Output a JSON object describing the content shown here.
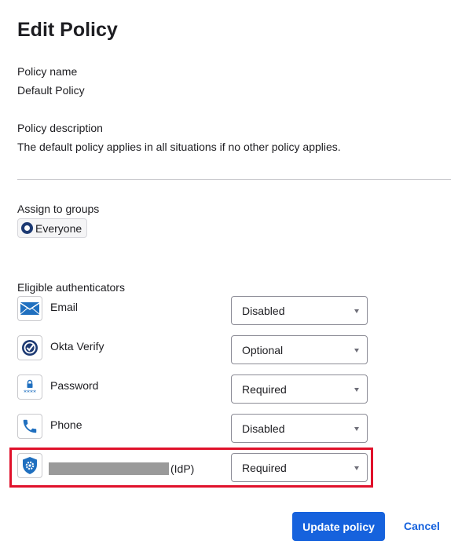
{
  "dialog": {
    "title": "Edit Policy"
  },
  "policy": {
    "name_label": "Policy name",
    "name_value": "Default Policy",
    "description_label": "Policy description",
    "description_value": "The default policy applies in all situations if no other policy applies."
  },
  "groups": {
    "label": "Assign to groups",
    "chips": [
      {
        "label": "Everyone",
        "icon": "group-circle-icon"
      }
    ]
  },
  "authenticators": {
    "label": "Eligible authenticators",
    "items": [
      {
        "name": "Email",
        "icon": "email-icon",
        "setting": "Disabled"
      },
      {
        "name": "Okta Verify",
        "icon": "okta-verify-icon",
        "setting": "Optional"
      },
      {
        "name": "Password",
        "icon": "password-icon",
        "setting": "Required"
      },
      {
        "name": "Phone",
        "icon": "phone-icon",
        "setting": "Disabled"
      },
      {
        "name": "(IdP)",
        "icon": "idp-shield-gear-icon",
        "setting": "Required",
        "name_redacted": true,
        "highlighted": true
      }
    ]
  },
  "actions": {
    "submit_label": "Update policy",
    "cancel_label": "Cancel"
  },
  "colors": {
    "primary": "#1662dd",
    "highlight": "#e0112b",
    "icon_blue": "#1f6fbf"
  }
}
